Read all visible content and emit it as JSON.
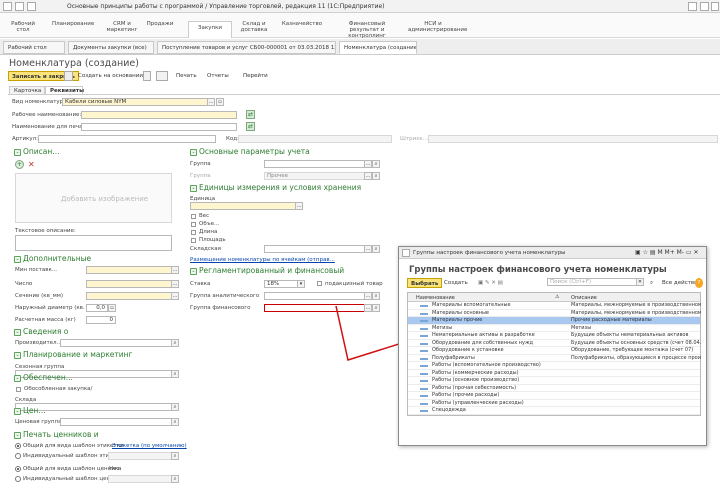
{
  "window": {
    "title": "Основные принципы работы с программой / Управление торговлей, редакция 11  (1С:Предприятие)"
  },
  "sections": [
    {
      "label": "Рабочий стол"
    },
    {
      "label": "Планирование"
    },
    {
      "label": "CRM и маркетинг"
    },
    {
      "label": "Продажи"
    },
    {
      "label": "Закупки"
    },
    {
      "label": "Склад и доставка"
    },
    {
      "label": "Казначейство"
    },
    {
      "label": "Финансовый результат и контроллинг"
    },
    {
      "label": "НСИ и администрирование"
    }
  ],
  "open_tabs": [
    {
      "label": "Рабочий стол"
    },
    {
      "label": "Документы закупки (все)"
    },
    {
      "label": "Поступление товаров и услуг СБ00-000001 от 03.03.2018 12:54:06 *"
    },
    {
      "label": "Номенклатура (создание)"
    }
  ],
  "form": {
    "title": "Номенклатура (создание)",
    "toolbar": {
      "save_close": "Записать и закрыть",
      "create_based": "Создать на основании",
      "print": "Печать",
      "reports": "Отчеты",
      "goto": "Перейти"
    },
    "tabs": [
      {
        "label": "Карточка"
      },
      {
        "label": "Реквизиты"
      }
    ],
    "fields": {
      "vid_label": "Вид номенклатуры:",
      "vid_value": "Кабели силовые NYM",
      "work_name_label": "Рабочее наименование:",
      "print_name_label": "Наименование для печати:",
      "artikul_label": "Артикул:",
      "kod_label": "Код:",
      "shtrih_label": "Штрихк..."
    },
    "left": {
      "description_group": "Описан...",
      "image_placeholder": "Добавить изображение",
      "text_desc_label": "Текстовое описание:",
      "additional_group": "Дополнительные",
      "min_post_label": "Мин поставк...",
      "chislo_label": "Число",
      "sechenie_label": "Сечение (кв_мм)",
      "diam_label": "Наружный диаметр (кв. мм)",
      "diam_value": "0,0",
      "mass_label": "Расчетная масса (кг)",
      "mass_value": "0",
      "svedenia_group": "Сведения о",
      "proizv_label": "Производител...",
      "plan_group": "Планирование и маркетинг",
      "season_label": "Сезонная группа",
      "obesp_group": "Обеспечен...",
      "obosob_label": "Обособленная закупка/",
      "sklad_label": "Склада",
      "ceny_group": "Цен...",
      "price_group_label": "Ценовая группа",
      "print_labels_group": "Печать ценников и",
      "radio1": "Общий для вида шаблон этикетки",
      "radio1_link": "Этикетка (по умолчанию)",
      "radio2": "Индивидуальный шаблон этикетки",
      "radio3": "Общий для вида шаблон ценника",
      "radio3_suffix": "Нет",
      "radio4": "Индивидуальный шаблон ценника"
    },
    "right": {
      "main_params_group": "Основные параметры учета",
      "group_label": "Группа",
      "gruppa_label": "Группа",
      "gruppa_value": "Прочее",
      "units_group": "Единицы измерения и условия хранения",
      "unit_label": "Единица",
      "ves_label": "Вес",
      "obem_label": "Объе...",
      "dlina_label": "Длина",
      "ploshad_label": "Площадь",
      "skladskaya_label": "Складская",
      "cells_link": "Размещение номенклатуры по ячейкам (отправ...",
      "reg_group": "Регламентированный и финансовый",
      "stavka_label": "Ставка",
      "stavka_value": "18%",
      "podakciz_label": "подакцизный товар",
      "analit_label": "Группа аналитического",
      "fin_label": "Группа финансового"
    }
  },
  "popup": {
    "window_title": "Группы настроек финансового учета номенклатуры",
    "title": "Группы настроек финансового учета номенклатуры",
    "buttons": {
      "select": "Выбрать",
      "create": "Создать",
      "search_placeholder": "Поиск (Ctrl+F)",
      "all_actions": "Все действия"
    },
    "columns": [
      "Наименование",
      "Описание"
    ],
    "rows": [
      {
        "name": "Материалы вспомогательные",
        "desc": "Материалы, межнормуемые в производственном проце..."
      },
      {
        "name": "Материалы основные",
        "desc": "Материалы, межнормуемые в производственном проце..."
      },
      {
        "name": "Материалы прочие",
        "desc": "Прочие расходные материалы",
        "selected": true
      },
      {
        "name": "Метизы",
        "desc": "Метизы"
      },
      {
        "name": "Нематериальные активы в разработке",
        "desc": "Будущие объекты нематериальных активов"
      },
      {
        "name": "Оборудование для собственных нужд",
        "desc": "Будущие объекты основных средств (счет 08.04.1)"
      },
      {
        "name": "Оборудование к установке",
        "desc": "Оборудование, требующее монтажа (счет 07)"
      },
      {
        "name": "Полуфабрикаты",
        "desc": "Полуфабрикаты, образующиеся в процессе производ..."
      },
      {
        "name": "Работы (вспомогательное производство)",
        "desc": ""
      },
      {
        "name": "Работы (коммерческие расходы)",
        "desc": ""
      },
      {
        "name": "Работы (основное производство)",
        "desc": ""
      },
      {
        "name": "Работы (прочая себестоимость)",
        "desc": ""
      },
      {
        "name": "Работы (прочие расходы)",
        "desc": ""
      },
      {
        "name": "Работы (управленческие расходы)",
        "desc": ""
      },
      {
        "name": "Спецодежда",
        "desc": ""
      }
    ]
  },
  "colors": {
    "accent_yellow": "#f9e37a",
    "group_green": "#2e7d32",
    "selection": "#a8c8f0",
    "annotation_red": "#d01010"
  }
}
